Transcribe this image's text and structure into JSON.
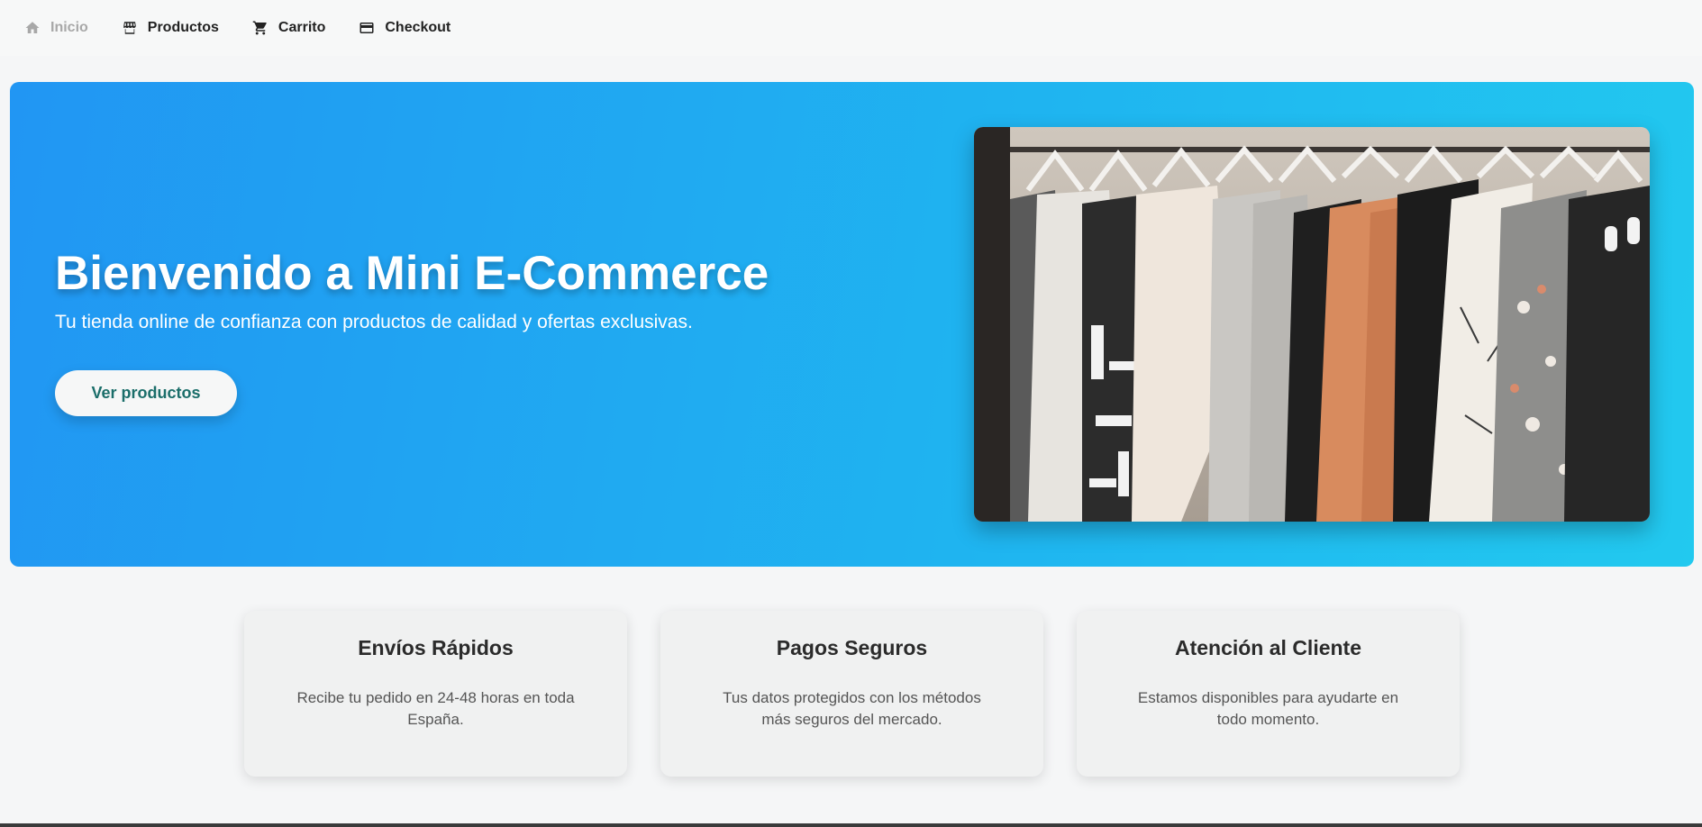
{
  "nav": {
    "items": [
      {
        "label": "Inicio",
        "icon": "home-icon",
        "disabled": true
      },
      {
        "label": "Productos",
        "icon": "store-icon"
      },
      {
        "label": "Carrito",
        "icon": "cart-icon"
      },
      {
        "label": "Checkout",
        "icon": "credit-card-icon"
      }
    ]
  },
  "hero": {
    "title": "Bienvenido a Mini E-Commerce",
    "subtitle": "Tu tienda online de confianza con productos de calidad y ofertas exclusivas.",
    "button_label": "Ver productos",
    "image": "clothing-rack-photo",
    "gradient": [
      "#2196f3",
      "#22c9ef"
    ]
  },
  "features": [
    {
      "title": "Envíos Rápidos",
      "text": "Recibe tu pedido en 24-48 horas en toda España."
    },
    {
      "title": "Pagos Seguros",
      "text": "Tus datos protegidos con los métodos más seguros del mercado."
    },
    {
      "title": "Atención al Cliente",
      "text": "Estamos disponibles para ayudarte en todo momento."
    }
  ],
  "colors": {
    "accent": "#2196f3",
    "button_text": "#1b6e6a",
    "disabled_nav": "#a8a8a8"
  }
}
